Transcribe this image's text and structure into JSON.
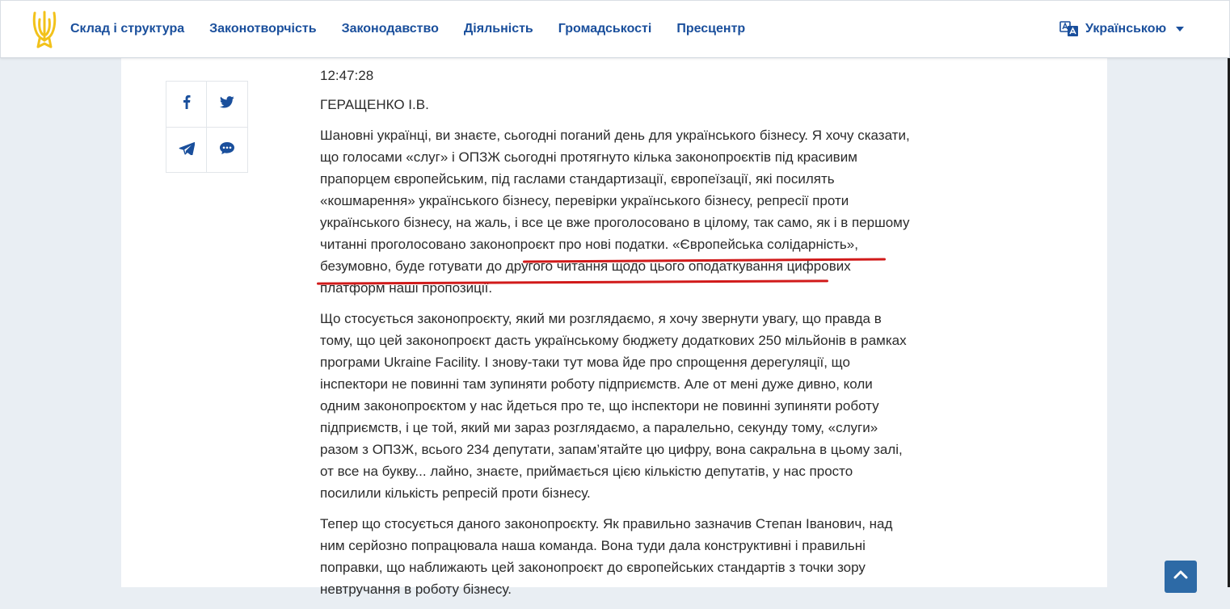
{
  "header": {
    "logo_icon": "trident-icon",
    "nav": [
      {
        "label": "Склад і структура"
      },
      {
        "label": "Законотворчість"
      },
      {
        "label": "Законодавство"
      },
      {
        "label": "Діяльність"
      },
      {
        "label": "Громадськості"
      },
      {
        "label": "Пресцентр"
      }
    ],
    "language": {
      "label": "Українською",
      "icon": "translate-icon"
    }
  },
  "share": {
    "buttons": [
      {
        "icon": "facebook-icon"
      },
      {
        "icon": "twitter-icon"
      },
      {
        "icon": "telegram-icon"
      },
      {
        "icon": "comment-icon"
      }
    ]
  },
  "article": {
    "time": "12:47:28",
    "speaker": "ГЕРАЩЕНКО І.В.",
    "paragraphs": [
      "Шановні українці, ви знаєте, сьогодні поганий день для українського бізнесу. Я хочу сказати, що голосами «слуг» і ОПЗЖ сьогодні протягнуто кілька законопроєктів під красивим прапорцем європейським, під гаслами стандартизації, європеїзації, які посилять «кошмарення» українського бізнесу, перевірки українського бізнесу, репресії проти українського бізнесу, на жаль, і все це вже проголосовано в цілому, так само, як і в першому читанні проголосовано законопроєкт про нові податки. «Європейська солідарність», безумовно, буде готувати до другого читання щодо цього оподаткування цифрових платформ наші пропозиції.",
      "Що стосується законопроєкту, який ми розглядаємо, я хочу звернути увагу, що правда в тому, що цей законопроєкт дасть українському бюджету додаткових 250 мільйонів в рамках програми Ukraine Facility. І знову-таки тут мова йде про спрощення дерегуляції, що інспектори не повинні там зупиняти роботу підприємств. Але от мені дуже дивно, коли одним законопроєктом у нас йдеться про те, що інспектори не повинні зупиняти роботу підприємств, і це той, який ми зараз розглядаємо, а паралельно, секунду тому, «слуги» разом з ОПЗЖ, всього 234 депутати, запам’ятайте цю цифру, вона сакральна в цьому залі, от все на букву... лайно, знаєте, приймається цією кількістю депутатів, у нас просто посилили кількість репресій проти бізнесу.",
      "Тепер що стосується даного законопроєкту. Як правильно зазначив Степан Іванович, над ним серйозно попрацювала наша команда. Вона туди дала конструктивні і правильні поправки, що наближають цей законопроєкт до європейських стандартів з точки зору невтручання в роботу бізнесу."
    ]
  },
  "annotation": {
    "color": "#d11a1a"
  },
  "scroll_top": {
    "icon": "chevron-up-icon"
  },
  "colors": {
    "brand": "#1a4f9c",
    "logo": "#f2c21b",
    "background": "#e9eef3",
    "accent_button": "#2d6aa6"
  }
}
